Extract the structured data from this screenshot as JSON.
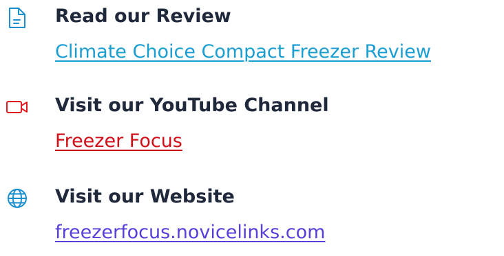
{
  "colors": {
    "heading": "#20283b",
    "review_link": "#1a9ed2",
    "youtube_link": "#d10f19",
    "website_link": "#5640d8",
    "icon_stroke": "#1a8fd0",
    "video_icon_stroke": "#e21a22"
  },
  "items": [
    {
      "icon": "document-icon",
      "heading": "Read our Review",
      "link_text": "Climate Choice Compact Freezer Review"
    },
    {
      "icon": "video-camera-icon",
      "heading": "Visit our YouTube Channel",
      "link_text": "Freezer Focus"
    },
    {
      "icon": "globe-icon",
      "heading": "Visit our Website",
      "link_text": "freezerfocus.novicelinks.com"
    }
  ]
}
